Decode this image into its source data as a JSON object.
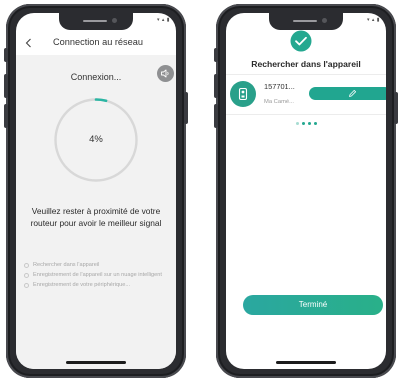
{
  "left_screen": {
    "header": {
      "title": "Connection au réseau",
      "back_icon": "chevron-left-icon"
    },
    "sound_icon": "speaker-mute-icon",
    "connexion_label": "Connexion...",
    "progress": {
      "value": 0.04,
      "label": "4%",
      "track_color": "#d8d8d8",
      "fill_color": "#2ab5a3"
    },
    "advice_text": "Veuillez rester à proximité de votre routeur pour avoir le meilleur signal",
    "steps": [
      "Rechercher dans l'appareil",
      "Enregistrement de l'appareil sur un nuage intelligent",
      "Enregistrement de votre périphérique..."
    ]
  },
  "right_screen": {
    "check_icon": "check-circle-icon",
    "title": "Rechercher dans l'appareil",
    "device": {
      "icon": "camera-device-icon",
      "name": "157701...",
      "subtitle": "Ma Camé...",
      "edit_icon": "pencil-icon"
    },
    "done_button": "Terminé"
  },
  "colors": {
    "accent": "#24a890",
    "screen_bg": "#f2f2f2",
    "phone_body": "#2b2c30"
  }
}
